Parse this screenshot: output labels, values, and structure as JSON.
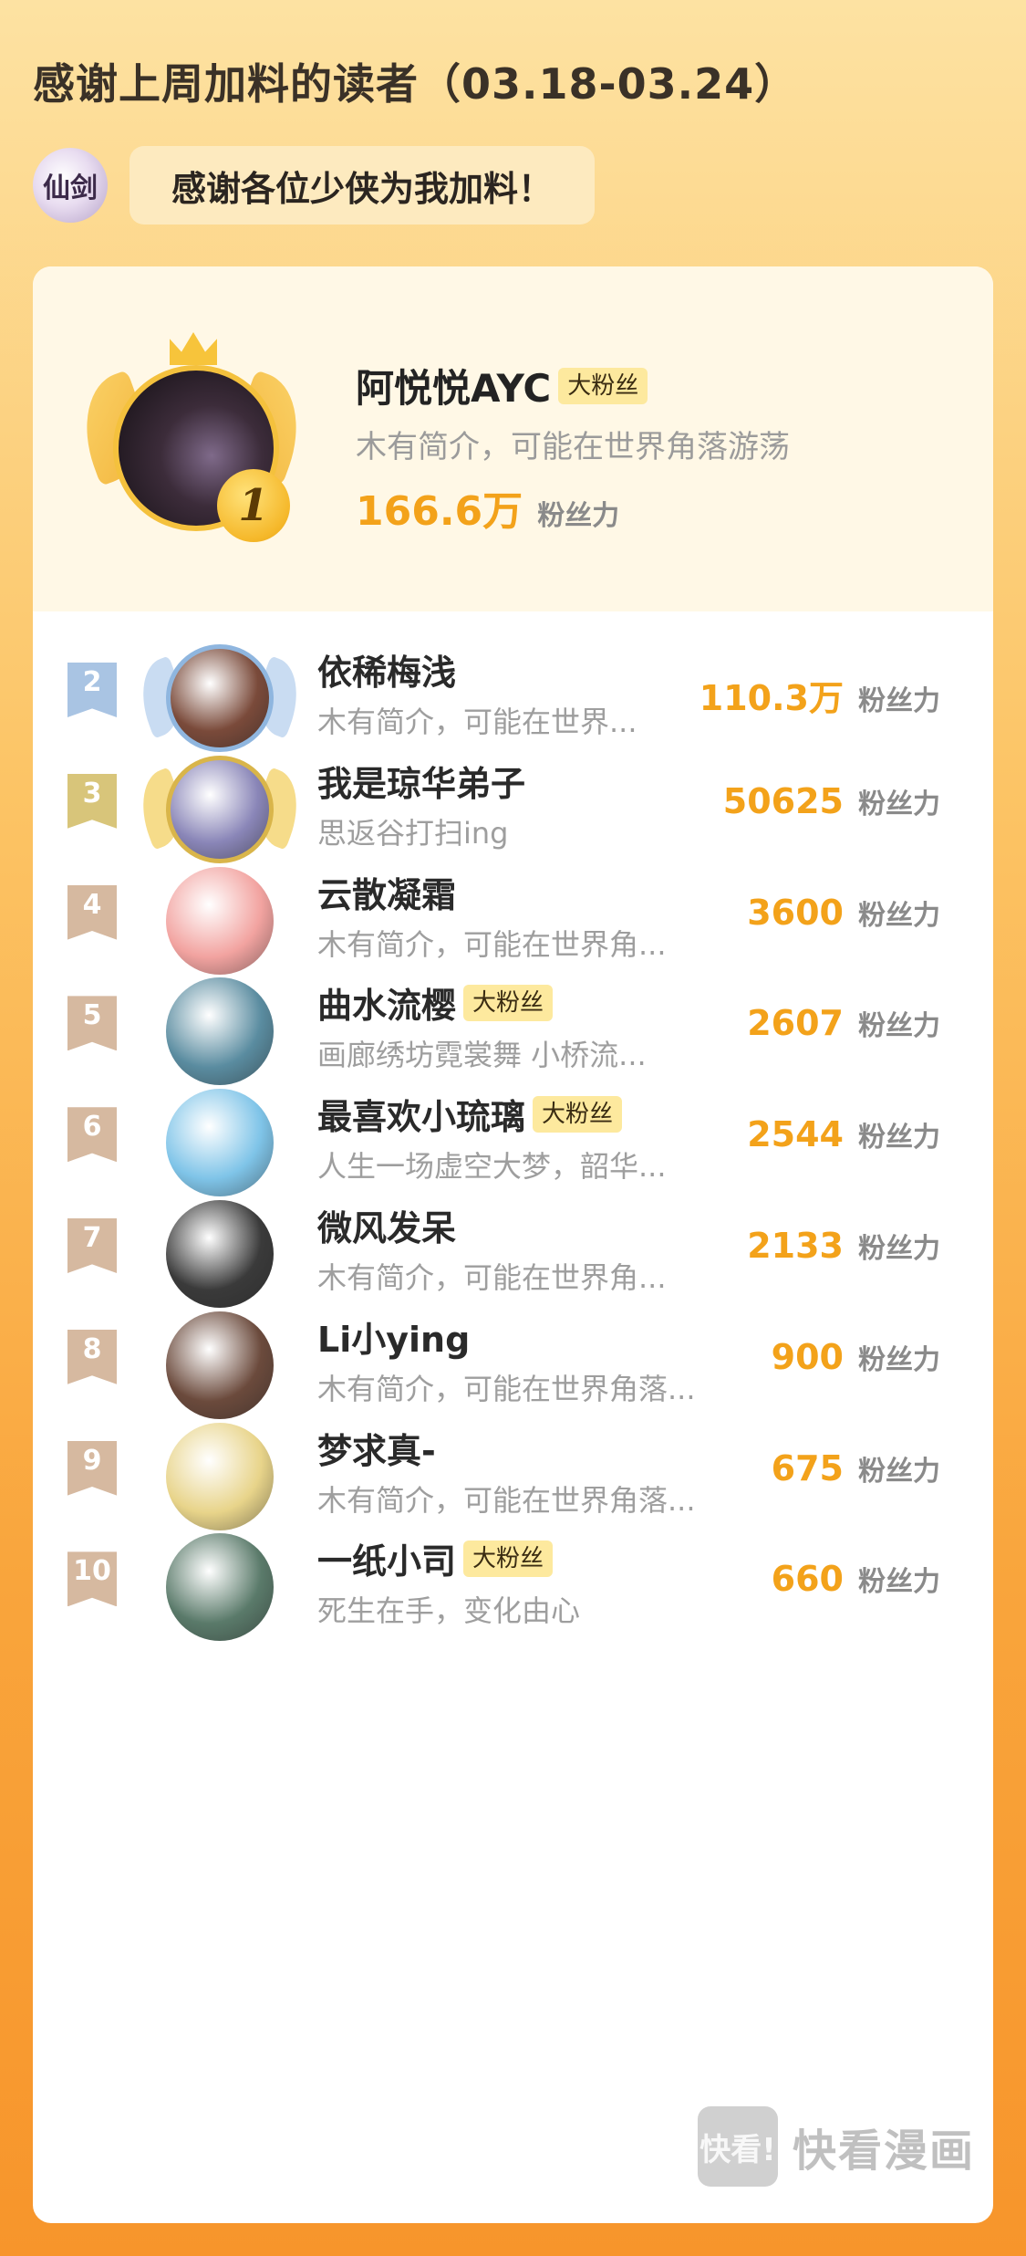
{
  "header": {
    "title": "感谢上周加料的读者（03.18-03.24）",
    "logo_text": "仙剑",
    "message": "感谢各位少侠为我加料！"
  },
  "unit_label": "粉丝力",
  "badge_label": "大粉丝",
  "top1": {
    "rank": "1",
    "name": "阿悦悦AYC",
    "badge": "大粉丝",
    "bio": "木有简介，可能在世界角落游荡",
    "score": "166.6万"
  },
  "rows": [
    {
      "rank": "2",
      "name": "依稀梅浅",
      "badge": "",
      "bio": "木有简介，可能在世界...",
      "score": "110.3万",
      "rank_color": "#a9c4e3",
      "avatar_color": "#7a4a3a"
    },
    {
      "rank": "3",
      "name": "我是琼华弟子",
      "badge": "",
      "bio": "思返谷打扫ing",
      "score": "50625",
      "rank_color": "#d8c57a",
      "avatar_color": "#8a86b8"
    },
    {
      "rank": "4",
      "name": "云散凝霜",
      "badge": "",
      "bio": "木有简介，可能在世界角...",
      "score": "3600",
      "rank_color": "#d6b9a0",
      "avatar_color": "#f2a3a0"
    },
    {
      "rank": "5",
      "name": "曲水流樱",
      "badge": "大粉丝",
      "bio": "画廊绣坊霓裳舞 小桥流...",
      "score": "2607",
      "rank_color": "#d6b9a0",
      "avatar_color": "#5a8ca0"
    },
    {
      "rank": "6",
      "name": "最喜欢小琉璃",
      "badge": "大粉丝",
      "bio": "人生一场虚空大梦，韶华...",
      "score": "2544",
      "rank_color": "#d6b9a0",
      "avatar_color": "#7fc4e8"
    },
    {
      "rank": "7",
      "name": "微风发呆",
      "badge": "",
      "bio": "木有简介，可能在世界角...",
      "score": "2133",
      "rank_color": "#d6b9a0",
      "avatar_color": "#3a3a3a"
    },
    {
      "rank": "8",
      "name": "Li小ying",
      "badge": "",
      "bio": "木有简介，可能在世界角落...",
      "score": "900",
      "rank_color": "#d6b9a0",
      "avatar_color": "#6b4a3c"
    },
    {
      "rank": "9",
      "name": "梦求真-",
      "badge": "",
      "bio": "木有简介，可能在世界角落...",
      "score": "675",
      "rank_color": "#d6b9a0",
      "avatar_color": "#e8d48a"
    },
    {
      "rank": "10",
      "name": "一纸小司",
      "badge": "大粉丝",
      "bio": "死生在手，变化由心",
      "score": "660",
      "rank_color": "#d6b9a0",
      "avatar_color": "#5a7a6a"
    }
  ],
  "watermark": {
    "logo": "快看!",
    "text": "快看漫画"
  }
}
